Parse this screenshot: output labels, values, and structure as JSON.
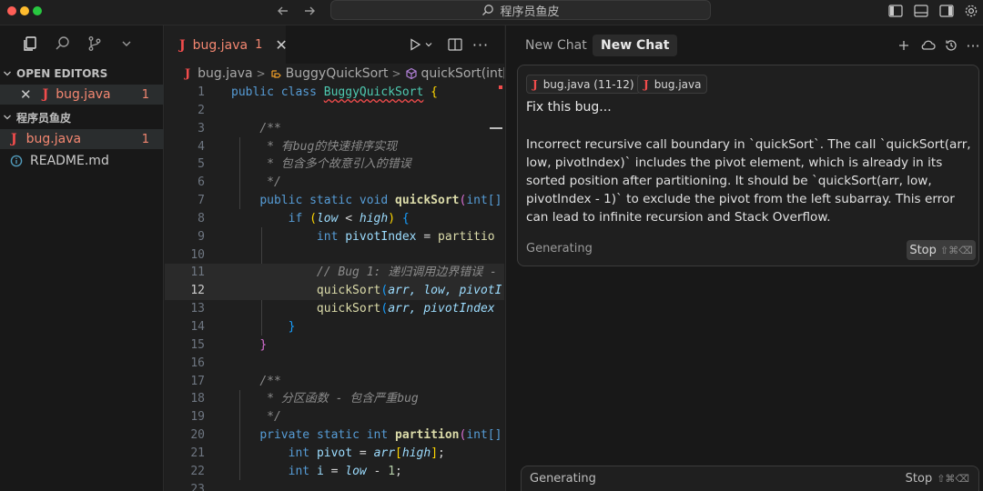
{
  "colors": {
    "traffic_close": "#ff5f57",
    "traffic_minimize": "#febc2e",
    "traffic_maximize": "#28c840",
    "error": "#f14c4c",
    "modified": "#f48771"
  },
  "titlebar": {
    "search_text": "程序员鱼皮"
  },
  "sidebar": {
    "open_editors_label": "OPEN EDITORS",
    "project_label": "程序员鱼皮",
    "open_editor_file": {
      "name": "bug.java",
      "problems": "1"
    },
    "files": [
      {
        "name": "bug.java",
        "problems": "1",
        "icon": "java-icon"
      },
      {
        "name": "README.md",
        "problems": "",
        "icon": "info-icon"
      }
    ]
  },
  "editor": {
    "tab": {
      "name": "bug.java",
      "problems": "1"
    },
    "breadcrumb": [
      "bug.java",
      "BuggyQuickSort",
      "quickSort(int["
    ],
    "line_numbers": [
      "1",
      "2",
      "3",
      "4",
      "5",
      "6",
      "7",
      "8",
      "9",
      "10",
      "11",
      "12",
      "13",
      "14",
      "15",
      "16",
      "17",
      "18",
      "19",
      "20",
      "21",
      "22",
      "23"
    ],
    "tokens": {
      "public": "public",
      "class": "class",
      "class_name": "BuggyQuickSort",
      "brace_open": "{",
      "brace_close": "}",
      "doc_open": "/**",
      "doc_line_1": " * 有bug的快速排序实现",
      "doc_line_2": " * 包含多个故意引入的错误",
      "doc_close": " */",
      "static": "static",
      "void": "void",
      "quickSort": "quickSort",
      "int_arr": "int[]",
      "if": "if",
      "paren_open": "(",
      "paren_close": ")",
      "low": "low",
      "lt": " < ",
      "high": "high",
      "int": "int",
      "pivotIndex": "pivotIndex",
      "assign": " = ",
      "partitio": "partitio",
      "bug_comment": "// Bug 1: 递归调用边界错误 -",
      "call1_args": "arr, low, pivotI",
      "call2_args": "arr, pivotIndex",
      "doc_line_3": " * 分区函数 - 包含严重bug",
      "private": "private",
      "partition": "partition",
      "pivot": "pivot",
      "arr": "arr",
      "bracket_open": "[",
      "bracket_close": "]",
      "semi": ";",
      "i": "i",
      "minus": " - ",
      "one": "1"
    }
  },
  "chat": {
    "tabs": [
      "New Chat",
      "New Chat"
    ],
    "context_chips": [
      "bug.java (11-12)",
      "bug.java"
    ],
    "prompt": "Fix this bug...",
    "response": "Incorrect recursive call boundary in `quickSort`. The call `quickSort(arr, low, pivotIndex)` includes the pivot element, which is already in its sorted position after partitioning. It should be `quickSort(arr, low, pivotIndex - 1)` to exclude the pivot from the left subarray. This error can lead to infinite recursion and Stack Overflow.",
    "status": "Generating",
    "stop_label": "Stop",
    "stop_shortcut": "⇧⌘⌫",
    "input_status": "Generating",
    "input_stop_label": "Stop",
    "input_stop_shortcut": "⇧⌘⌫"
  }
}
